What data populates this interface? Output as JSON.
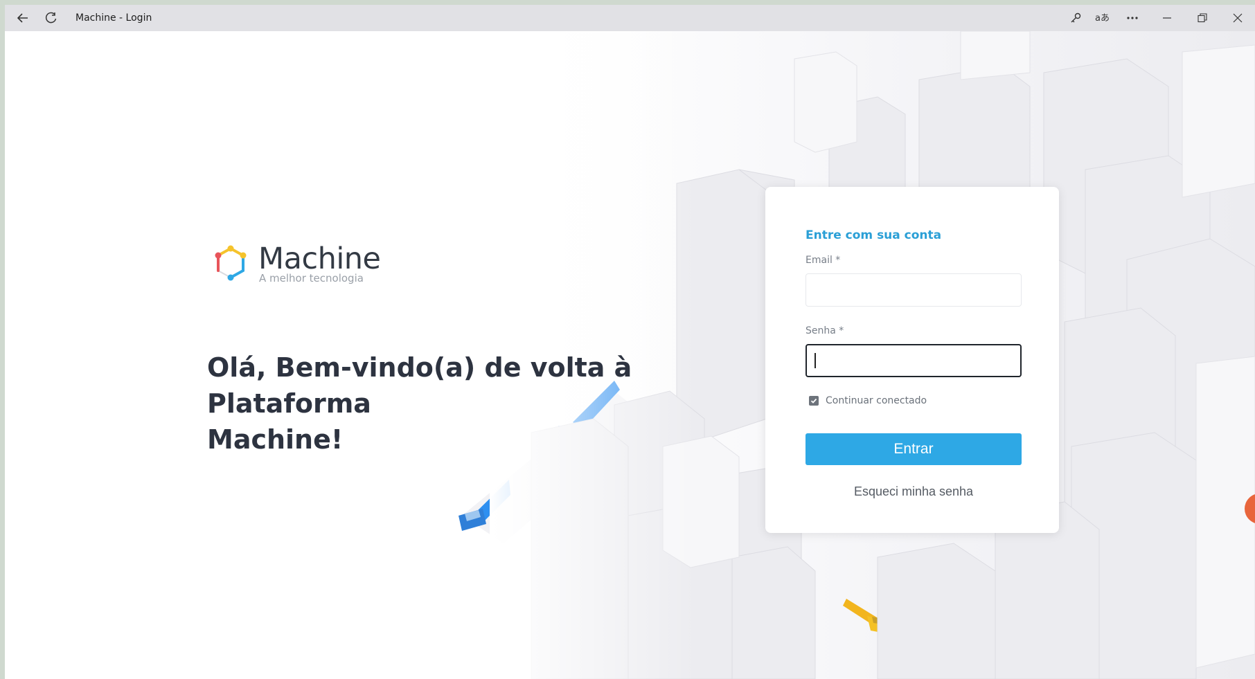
{
  "window": {
    "title": "Machine - Login",
    "icons": [
      "back-arrow-icon",
      "refresh-icon",
      "key-icon",
      "translate-icon",
      "more-icon",
      "minimize-icon",
      "restore-icon",
      "close-icon"
    ]
  },
  "brand": {
    "name": "Machine",
    "tagline": "A melhor tecnologia",
    "colors": {
      "red": "#e8545a",
      "yellow": "#f5c32c",
      "blue": "#2ea8e5",
      "text": "#333a44"
    }
  },
  "hero": {
    "headline_line1": "Olá, Bem-vindo(a) de volta à Plataforma",
    "headline_line2": "Machine!"
  },
  "login": {
    "title": "Entre com sua conta",
    "email_label": "Email *",
    "email_value": "",
    "password_label": "Senha *",
    "password_value": "",
    "remember_label": "Continuar conectado",
    "remember_checked": true,
    "submit_label": "Entrar",
    "forgot_label": "Esqueci minha senha",
    "accent_color": "#2ea8e5"
  }
}
